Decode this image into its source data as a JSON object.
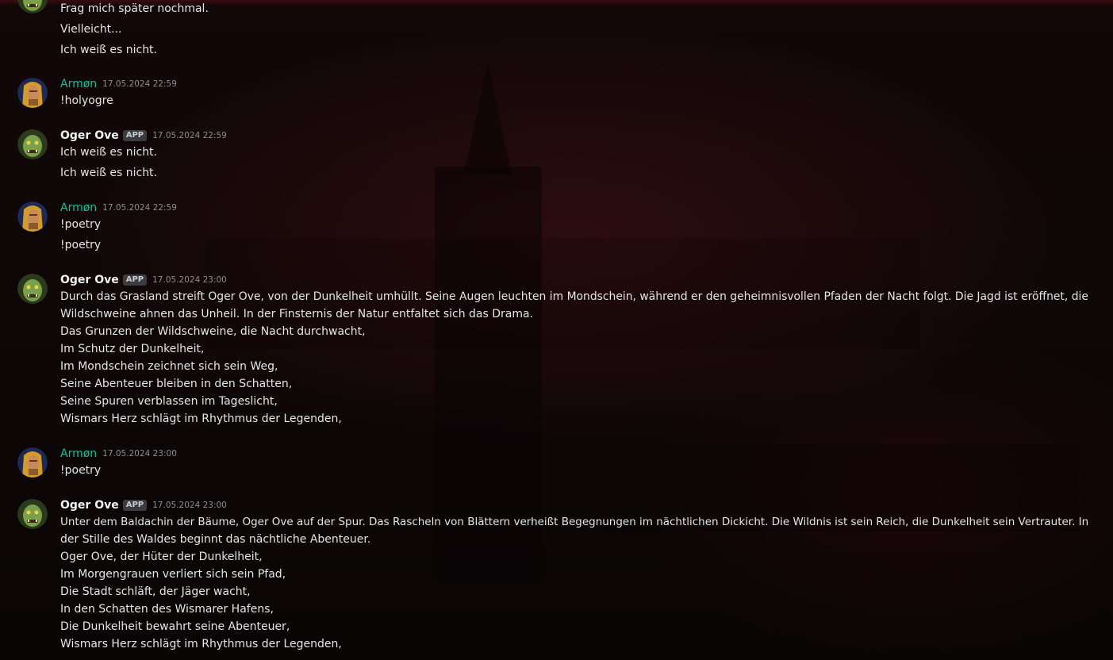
{
  "messages": {
    "m0": {
      "lines": [
        "Frag mich später nochmal.",
        "Vielleicht...",
        "Ich weiß es nicht."
      ]
    },
    "m1": {
      "author": "Armøn",
      "timestamp": "17.05.2024 22:59",
      "lines": [
        "!holyogre"
      ]
    },
    "m2": {
      "author": "Oger Ove",
      "badge": "APP",
      "timestamp": "17.05.2024 22:59",
      "lines": [
        "Ich weiß es nicht.",
        "Ich weiß es nicht."
      ]
    },
    "m3": {
      "author": "Armøn",
      "timestamp": "17.05.2024 22:59",
      "lines": [
        "!poetry",
        "!poetry"
      ]
    },
    "m4": {
      "author": "Oger Ove",
      "badge": "APP",
      "timestamp": "17.05.2024 23:00",
      "lines": [
        "Durch das Grasland streift Oger Ove, von der Dunkelheit umhüllt. Seine Augen leuchten im Mondschein, während er den geheimnisvollen Pfaden der Nacht folgt. Die Jagd ist eröffnet, die",
        "Wildschweine ahnen das Unheil. In der Finsternis der Natur entfaltet sich das Drama.",
        "Das Grunzen der Wildschweine, die Nacht durchwacht,",
        "Im Schutz der Dunkelheit,",
        "Im Mondschein zeichnet sich sein Weg,",
        "Seine Abenteuer bleiben in den Schatten,",
        "Seine Spuren verblassen im Tageslicht,",
        "Wismars Herz schlägt im Rhythmus der Legenden,"
      ]
    },
    "m5": {
      "author": "Armøn",
      "timestamp": "17.05.2024 23:00",
      "lines": [
        "!poetry"
      ]
    },
    "m6": {
      "author": "Oger Ove",
      "badge": "APP",
      "timestamp": "17.05.2024 23:00",
      "lines": [
        "Unter dem Baldachin der Bäume, Oger Ove auf der Spur. Das Rascheln von Blättern verheißt Begegnungen im nächtlichen Dickicht. Die Wildnis ist sein Reich, die Dunkelheit sein Vertrauter. In",
        "der Stille des Waldes beginnt das nächtliche Abenteuer.",
        "Oger Ove, der Hüter der Dunkelheit,",
        "Im Morgengrauen verliert sich sein Pfad,",
        "Die Stadt schläft, der Jäger wacht,",
        "In den Schatten des Wismarer Hafens,",
        "Die Dunkelheit bewahrt seine Abenteuer,",
        "Wismars Herz schlägt im Rhythmus der Legenden,"
      ]
    }
  },
  "colors": {
    "armon_name": "#1abc9c",
    "ogre_name": "#f2f3f5",
    "background": "#0d0708"
  },
  "icons": {
    "ogre_avatar": "ogre-face-avatar",
    "armon_avatar": "blond-warrior-avatar"
  }
}
